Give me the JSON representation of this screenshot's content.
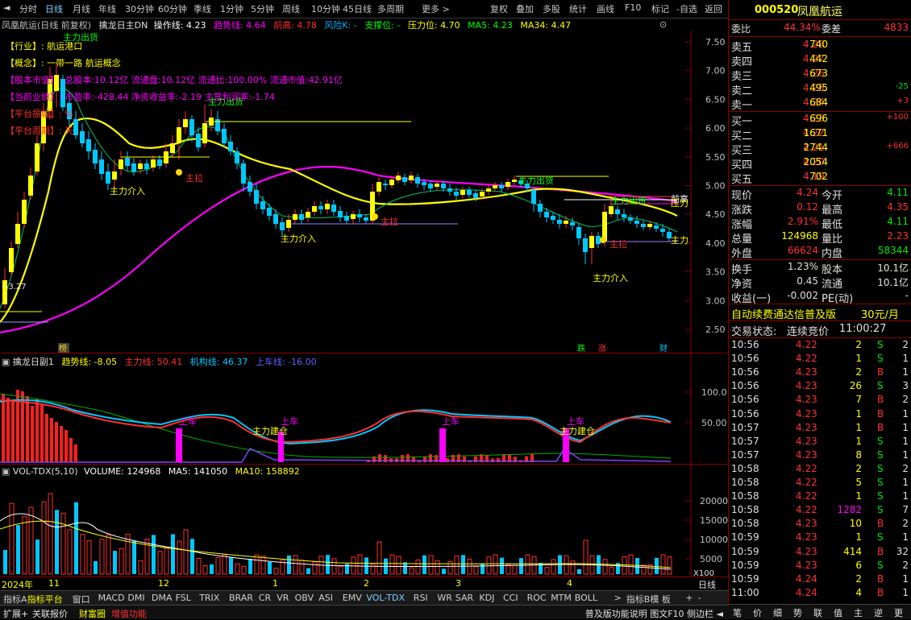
{
  "topmenu": {
    "periods": [
      "分时",
      "日线",
      "月线",
      "年线",
      "30分钟",
      "60分钟",
      "季线",
      "1分钟",
      "5分钟",
      "周线",
      "10分钟",
      "45日线",
      "多周期",
      "更多 >"
    ],
    "tools": [
      "复权",
      "叠加",
      "多股",
      "统计",
      "画线",
      "F10",
      "标记",
      "-自选",
      "返回"
    ]
  },
  "titleline": {
    "stock": "凤凰航运(日线 前复权)",
    "indicator": "擒龙日主DN",
    "op_label": "操作线: 4.23",
    "trend_label": "趋势线: 4.64",
    "high_label": "前高: 4.78",
    "risk_label": "风险K: -",
    "support_label": "支撑位: -",
    "pressure_label": "压力位: 4.70",
    "ma5_label": "MA5: 4.23",
    "ma34_label": "MA34: 4.47"
  },
  "info_lines": [
    "【行业】: 航运港口",
    "【概念】: 一带一路 航运概念",
    "【股本市值】: 总股本:10.12亿 流通盘:10.12亿 流通比:100.00% 流通市值:42.91亿",
    "【当前业绩】: 市盈率:-428.44 净资收益率:-2.19 主营利润率:-1.74",
    "【平台振幅】:          %",
    "【平台周期】:          天"
  ],
  "main_chart": {
    "y_ticks": [
      "7.50",
      "7.00",
      "6.50",
      "6.00",
      "5.50",
      "5.00",
      "4.50",
      "4.00",
      "3.50",
      "3.00",
      "2.50"
    ],
    "annotations": [
      "主力出货",
      "主力出货",
      "主力出货",
      "主力出货",
      "主力介入",
      "主力介入",
      "主力介入",
      "主拉",
      "主拉",
      "主拉",
      "主力",
      "前高",
      "压力"
    ],
    "low_label": "3.27",
    "markers": [
      "榜",
      "跌",
      "涨",
      "财"
    ]
  },
  "sub1": {
    "title": "擒龙日副1",
    "trend": "趋势线: -8.05",
    "main": "主力线: 50.41",
    "inst": "机构线: 46.37",
    "board": "上车线: -16.00",
    "y_ticks": [
      "100.0",
      "50.00"
    ],
    "annotations": [
      "上车",
      "主力建仓",
      "上车",
      "上车",
      "上车",
      "主力建仓"
    ]
  },
  "sub2": {
    "title": "VOL-TDX(5,10)",
    "volume": "VOLUME: 124968",
    "ma5": "MA5: 141050",
    "ma10": "MA10: 158892",
    "y_ticks": [
      "20000",
      "15000",
      "10000",
      "5000"
    ],
    "unit": "X100"
  },
  "xaxis": {
    "labels": [
      "2024年",
      "11",
      "12",
      "1",
      "2",
      "3",
      "4"
    ],
    "period": "日线"
  },
  "tabs1": [
    "指标A",
    "指标平台",
    "窗口",
    "MACD",
    "DMI",
    "DMA",
    "FSL",
    "TRIX",
    "BRAR",
    "CR",
    "VR",
    "OBV",
    "ASI",
    "EMV",
    "VOL-TDX",
    "RSI",
    "WR",
    "SAR",
    "KDJ",
    "CCI",
    "ROC",
    "MTM",
    "BOLL",
    ">",
    "指标B",
    "模 板",
    "+",
    "-"
  ],
  "tabs2": [
    "扩展+",
    "关联报价",
    "财富圈",
    "增值功能"
  ],
  "tabs2_right": "普及版功能说明 图文F10 侧边栏 ◄",
  "quote": {
    "code": "000520",
    "name": "凤凰航运",
    "webi_label": "委比",
    "webi": "44.34%",
    "weicha_label": "委差",
    "weicha": "4833",
    "asks": [
      {
        "label": "卖五",
        "price": "4.28",
        "vol": "740",
        "chg": ""
      },
      {
        "label": "卖四",
        "price": "4.27",
        "vol": "442",
        "chg": ""
      },
      {
        "label": "卖三",
        "price": "4.26",
        "vol": "673",
        "chg": ""
      },
      {
        "label": "卖二",
        "price": "4.25",
        "vol": "495",
        "chg": "-25"
      },
      {
        "label": "卖一",
        "price": "4.24",
        "vol": "684",
        "chg": "+3"
      }
    ],
    "bids": [
      {
        "label": "买一",
        "price": "4.23",
        "vol": "696",
        "chg": "+100"
      },
      {
        "label": "买二",
        "price": "4.22",
        "vol": "1671",
        "chg": ""
      },
      {
        "label": "买三",
        "price": "4.21",
        "vol": "2744",
        "chg": "+666"
      },
      {
        "label": "买四",
        "price": "4.20",
        "vol": "2054",
        "chg": ""
      },
      {
        "label": "买五",
        "price": "4.19",
        "vol": "702",
        "chg": ""
      }
    ],
    "stats": [
      {
        "l1": "现价",
        "v1": "4.24",
        "l2": "今开",
        "v2": "4.11",
        "c1": "red",
        "c2": "grn"
      },
      {
        "l1": "涨跌",
        "v1": "0.12",
        "l2": "最高",
        "v2": "4.35",
        "c1": "red",
        "c2": "red"
      },
      {
        "l1": "涨幅",
        "v1": "2.91%",
        "l2": "最低",
        "v2": "4.11",
        "c1": "red",
        "c2": "grn"
      },
      {
        "l1": "总量",
        "v1": "124968",
        "l2": "量比",
        "v2": "2.23",
        "c1": "yel",
        "c2": "red"
      },
      {
        "l1": "外盘",
        "v1": "66624",
        "l2": "内盘",
        "v2": "58344",
        "c1": "red",
        "c2": "grn"
      }
    ],
    "stats2": [
      {
        "l1": "换手",
        "v1": "1.23%",
        "l2": "股本",
        "v2": "10.1亿"
      },
      {
        "l1": "净资",
        "v1": "0.45",
        "l2": "流通",
        "v2": "10.1亿"
      },
      {
        "l1": "收益(一)",
        "v1": "-0.002",
        "l2": "PE(动)",
        "v2": "-"
      }
    ],
    "promo": "自动续费通达信普及版",
    "promo_price": "30元/月",
    "trade_state_label": "交易状态:",
    "trade_state": "连续竞价",
    "trade_time": "11:00:27",
    "ticks": [
      {
        "t": "10:56",
        "p": "4.22",
        "v": "2",
        "bs": "S",
        "n": "2"
      },
      {
        "t": "10:56",
        "p": "4.22",
        "v": "1",
        "bs": "S",
        "n": "1"
      },
      {
        "t": "10:56",
        "p": "4.23",
        "v": "2",
        "bs": "B",
        "n": "1"
      },
      {
        "t": "10:56",
        "p": "4.23",
        "v": "26",
        "bs": "S",
        "n": "3"
      },
      {
        "t": "10:56",
        "p": "4.23",
        "v": "7",
        "bs": "B",
        "n": "2"
      },
      {
        "t": "10:56",
        "p": "4.23",
        "v": "1",
        "bs": "B",
        "n": "1"
      },
      {
        "t": "10:57",
        "p": "4.23",
        "v": "1",
        "bs": "B",
        "n": "1"
      },
      {
        "t": "10:57",
        "p": "4.23",
        "v": "1",
        "bs": "S",
        "n": "1"
      },
      {
        "t": "10:57",
        "p": "4.23",
        "v": "8",
        "bs": "S",
        "n": "1"
      },
      {
        "t": "10:58",
        "p": "4.22",
        "v": "2",
        "bs": "S",
        "n": "2"
      },
      {
        "t": "10:58",
        "p": "4.22",
        "v": "5",
        "bs": "S",
        "n": "1"
      },
      {
        "t": "10:58",
        "p": "4.22",
        "v": "1",
        "bs": "S",
        "n": "1"
      },
      {
        "t": "10:58",
        "p": "4.22",
        "v": "1282",
        "bs": "S",
        "n": "7"
      },
      {
        "t": "10:58",
        "p": "4.23",
        "v": "10",
        "bs": "B",
        "n": "2"
      },
      {
        "t": "10:59",
        "p": "4.23",
        "v": "1",
        "bs": "S",
        "n": "1"
      },
      {
        "t": "10:59",
        "p": "4.23",
        "v": "414",
        "bs": "B",
        "n": "32"
      },
      {
        "t": "10:59",
        "p": "4.23",
        "v": "6",
        "bs": "S",
        "n": "2"
      },
      {
        "t": "10:59",
        "p": "4.24",
        "v": "2",
        "bs": "B",
        "n": "1"
      },
      {
        "t": "11:00",
        "p": "4.24",
        "v": "4",
        "bs": "B",
        "n": "1"
      }
    ],
    "bottom_tabs": [
      "笔",
      "价",
      "细",
      "势",
      "联",
      "值",
      "主",
      "逆",
      "更"
    ]
  }
}
